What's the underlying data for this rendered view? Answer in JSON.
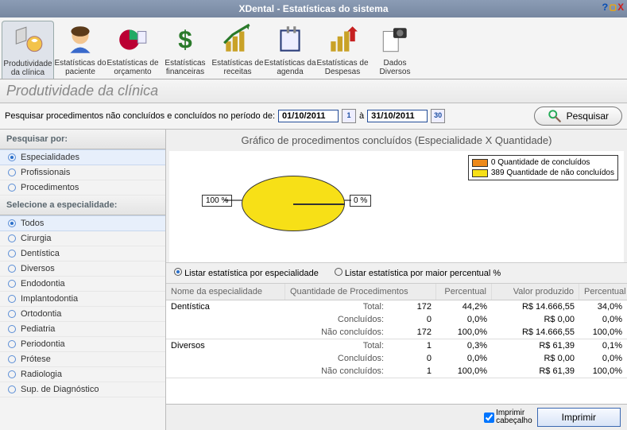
{
  "window": {
    "title": "XDental - Estatísticas do sistema"
  },
  "toolbar": {
    "items": [
      {
        "line1": "Produtividade",
        "line2": "da clínica",
        "icon": "productivity-icon"
      },
      {
        "line1": "Estatísticas do",
        "line2": "paciente",
        "icon": "patient-icon"
      },
      {
        "line1": "Estatísticas de",
        "line2": "orçamento",
        "icon": "budget-icon"
      },
      {
        "line1": "Estatísticas",
        "line2": "financeiras",
        "icon": "finance-icon"
      },
      {
        "line1": "Estatísticas de",
        "line2": "receitas",
        "icon": "revenue-icon"
      },
      {
        "line1": "Estatísticas da",
        "line2": "agenda",
        "icon": "agenda-icon"
      },
      {
        "line1": "Estatísticas de",
        "line2": "Despesas",
        "icon": "expense-icon"
      },
      {
        "line1": "Dados",
        "line2": "Diversos",
        "icon": "misc-icon"
      }
    ]
  },
  "page": {
    "title": "Produtividade da clínica"
  },
  "search": {
    "label": "Pesquisar procedimentos não concluídos e concluídos no período de:",
    "from": "01/10/2011",
    "to_label": "à",
    "to": "31/10/2011",
    "button": "Pesquisar"
  },
  "sidebar": {
    "head1": "Pesquisar por:",
    "group1": [
      {
        "label": "Especialidades",
        "selected": true
      },
      {
        "label": "Profissionais",
        "selected": false
      },
      {
        "label": "Procedimentos",
        "selected": false
      }
    ],
    "head2": "Selecione a especialidade:",
    "group2": [
      {
        "label": "Todos",
        "selected": true
      },
      {
        "label": "Cirurgia",
        "selected": false
      },
      {
        "label": "Dentística",
        "selected": false
      },
      {
        "label": "Diversos",
        "selected": false
      },
      {
        "label": "Endodontia",
        "selected": false
      },
      {
        "label": "Implantodontia",
        "selected": false
      },
      {
        "label": "Ortodontia",
        "selected": false
      },
      {
        "label": "Pediatria",
        "selected": false
      },
      {
        "label": "Periodontia",
        "selected": false
      },
      {
        "label": "Prótese",
        "selected": false
      },
      {
        "label": "Radiologia",
        "selected": false
      },
      {
        "label": "Sup. de Diagnóstico",
        "selected": false
      }
    ]
  },
  "chart": {
    "title": "Gráfico de procedimentos concluídos (Especialidade X Quantidade)",
    "legend": [
      {
        "color": "orange",
        "text": "0 Quantidade de concluídos"
      },
      {
        "color": "yellow",
        "text": "389 Quantidade de não concluídos"
      }
    ],
    "callouts": {
      "left": "100 %",
      "right": "0 %"
    }
  },
  "chart_data": {
    "type": "pie",
    "title": "Gráfico de procedimentos concluídos (Especialidade X Quantidade)",
    "series": [
      {
        "name": "Quantidade de concluídos",
        "value": 0,
        "percent": 0,
        "color": "#ed8a1c"
      },
      {
        "name": "Quantidade de não concluídos",
        "value": 389,
        "percent": 100,
        "color": "#f7e017"
      }
    ]
  },
  "options": {
    "opt1": "Listar estatística por especialidade",
    "opt2": "Listar estatística por maior percentual %"
  },
  "table": {
    "headers": {
      "c1": "Nome da especialidade",
      "c2": "Quantidade de Procedimentos",
      "c3": "Percentual",
      "c4": "Valor produzido",
      "c5": "Percentual"
    },
    "row_labels": {
      "total": "Total:",
      "done": "Concluídos:",
      "undone": "Não concluídos:"
    },
    "groups": [
      {
        "name": "Dentística",
        "rows": [
          {
            "q": "172",
            "p": "44,2%",
            "v": "R$ 14.666,55",
            "p2": "34,0%"
          },
          {
            "q": "0",
            "p": "0,0%",
            "v": "R$ 0,00",
            "p2": "0,0%"
          },
          {
            "q": "172",
            "p": "100,0%",
            "v": "R$ 14.666,55",
            "p2": "100,0%"
          }
        ]
      },
      {
        "name": "Diversos",
        "rows": [
          {
            "q": "1",
            "p": "0,3%",
            "v": "R$ 61,39",
            "p2": "0,1%"
          },
          {
            "q": "0",
            "p": "0,0%",
            "v": "R$ 0,00",
            "p2": "0,0%"
          },
          {
            "q": "1",
            "p": "100,0%",
            "v": "R$ 61,39",
            "p2": "100,0%"
          }
        ]
      }
    ]
  },
  "footer": {
    "check_label1": "Imprimir",
    "check_label2": "cabeçalho",
    "print_button": "Imprimir"
  }
}
